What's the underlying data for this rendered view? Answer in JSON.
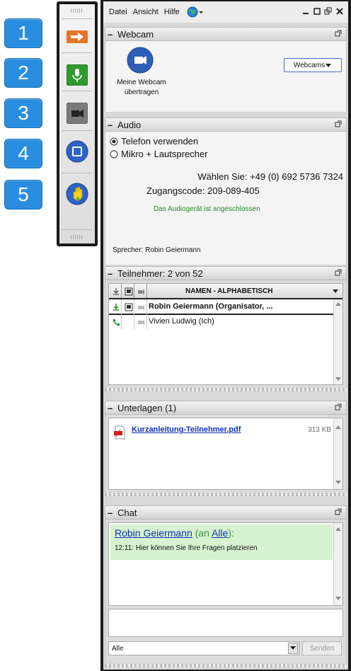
{
  "markers": [
    "1",
    "2",
    "3",
    "4",
    "5"
  ],
  "menubar": {
    "file": "Datei",
    "view": "Ansicht",
    "help": "Hilfe"
  },
  "webcam": {
    "title": "Webcam",
    "caption_line1": "Meine Webcam",
    "caption_line2": "übertragen",
    "dropdown": "Webcams"
  },
  "audio": {
    "title": "Audio",
    "option_phone": "Telefon verwenden",
    "option_mic": "Mikro + Lautsprecher",
    "dial_label": "Wählen Sie: +49 (0) 692 5736 7324",
    "access_code": "Zugangscode: 209-089-405",
    "device_status": "Das Audiogerät ist angeschlossen",
    "speaker": "Sprecher: Robin Geiermann"
  },
  "participants": {
    "title": "Teilnehmer:  2 von 52",
    "column_header": "NAMEN - ALPHABETISCH",
    "rows": [
      {
        "name": "Robin Geiermann (Organisator, ..."
      },
      {
        "name": "Vivien Ludwig (Ich)"
      }
    ]
  },
  "documents": {
    "title": "Unterlagen (1)",
    "file_name": "Kurzanleitung-Teilnehmer.pdf",
    "file_size": "313 KB"
  },
  "chat": {
    "title": "Chat",
    "sender": "Robin Geiermann",
    "to_prefix": " (an ",
    "recipient": "Alle",
    "to_suffix": "):",
    "message": "12:11: Hier können Sie Ihre Fragen platzieren",
    "recipient_select": "Alle",
    "send_label": "Senden"
  },
  "colors": {
    "accent_blue": "#2a8ee0",
    "status_green": "#1e8a1e",
    "chat_bg": "#d6f2d0",
    "link_blue": "#1030b8"
  }
}
